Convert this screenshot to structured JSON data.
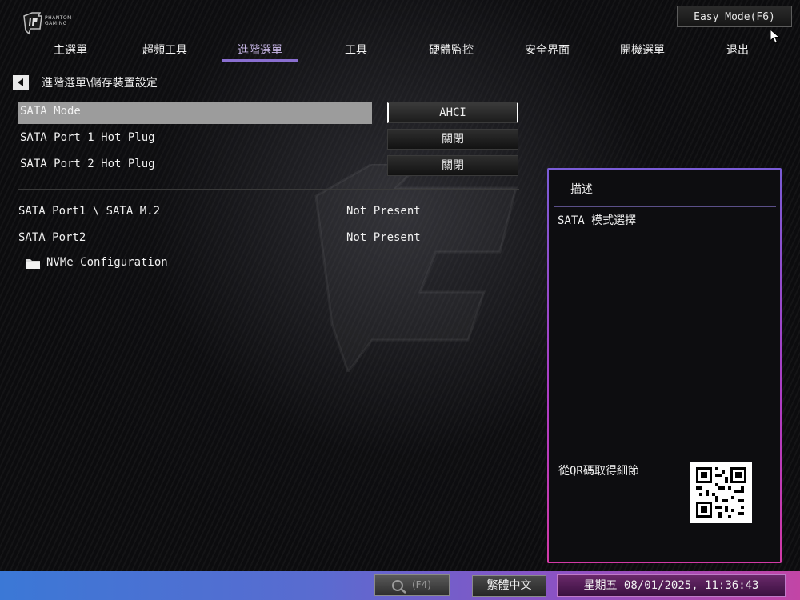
{
  "header": {
    "easy_mode_label": "Easy Mode(F6)"
  },
  "tabs": [
    {
      "label": "主選單"
    },
    {
      "label": "超頻工具"
    },
    {
      "label": "進階選單"
    },
    {
      "label": "工具"
    },
    {
      "label": "硬體監控"
    },
    {
      "label": "安全界面"
    },
    {
      "label": "開機選單"
    },
    {
      "label": "退出"
    }
  ],
  "active_tab": "進階選單",
  "breadcrumb": "進階選單\\儲存裝置設定",
  "settings": [
    {
      "label": "SATA Mode",
      "value": "AHCI",
      "selected": true
    },
    {
      "label": "SATA Port 1 Hot Plug",
      "value": "關閉"
    },
    {
      "label": "SATA Port 2 Hot Plug",
      "value": "關閉"
    }
  ],
  "info_rows": [
    {
      "label": "SATA Port1 \\ SATA M.2",
      "value": "Not Present"
    },
    {
      "label": "SATA Port2",
      "value": "Not Present"
    }
  ],
  "submenu": {
    "label": "NVMe Configuration",
    "icon": "folder-icon"
  },
  "description": {
    "title": "描述",
    "text": "SATA 模式選擇",
    "qr_label": "從QR碼取得細節"
  },
  "statusbar": {
    "search_label": "(F4)",
    "language": "繁體中文",
    "datetime": "星期五 08/01/2025, 11:36:43"
  },
  "colors": {
    "accent": "#8a6fd0",
    "selected_row": "#9c9c9c",
    "panel_border": "#b03cc4"
  }
}
